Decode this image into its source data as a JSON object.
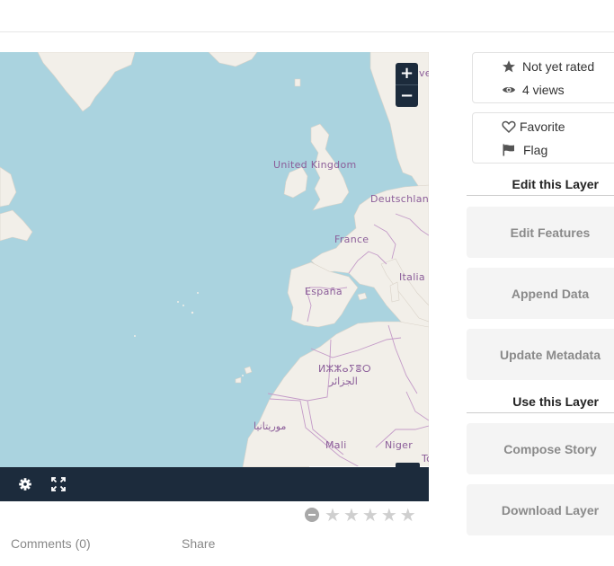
{
  "map": {
    "zoom_in": "+",
    "zoom_out": "−",
    "labels": {
      "uk": "United Kingdom",
      "de": "Deutschlan",
      "fr": "France",
      "it": "Italia",
      "es": "España",
      "dz_tifinagh": "ⵍⵣⵣⴰⵢⴻⵔ",
      "dz_arabic": "الجزائر",
      "mr": "موريتانيا",
      "ml": "Mali",
      "ne": "Niger",
      "ve": "ve",
      "tr": "Tc"
    },
    "colors": {
      "water": "#aad3df",
      "land": "#f2efe9",
      "border": "#c49bc8"
    }
  },
  "toolbar": {
    "settings_icon": "gear-icon",
    "fullscreen_icon": "fullscreen-icon"
  },
  "rating": {
    "stars": 5,
    "value": 0
  },
  "links": {
    "comments": "Comments (0)",
    "share": "Share"
  },
  "stats": {
    "rating_label": "Not yet rated",
    "views_label": "4 views"
  },
  "actions": {
    "favorite": "Favorite",
    "flag": "Flag"
  },
  "edit_section": {
    "title": "Edit this Layer",
    "buttons": [
      "Edit Features",
      "Append Data",
      "Update Metadata"
    ]
  },
  "use_section": {
    "title": "Use this Layer",
    "buttons": [
      "Compose Story",
      "Download Layer"
    ]
  }
}
